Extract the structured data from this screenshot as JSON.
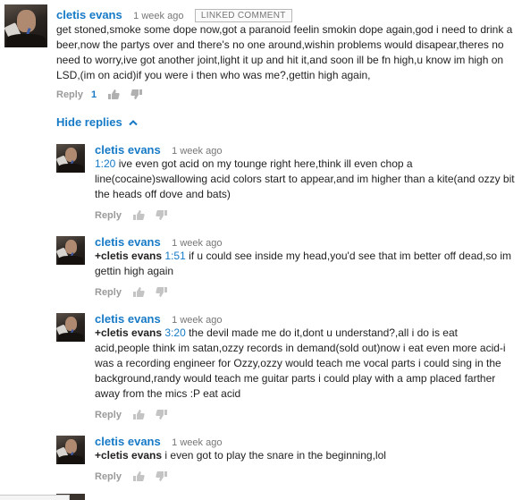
{
  "top_comment": {
    "author": "cletis evans",
    "time": "1 week ago",
    "badge": "LINKED COMMENT",
    "text": "get stoned,smoke some dope now,got a paranoid feelin smokin dope again,god i need to drink a beer,now the partys over and there's no one around,wishin problems would disapear,theres no need to worry,ive got another joint,light it up and hit it,and soon ill be fn high,u know im high on LSD,(im on acid)if you were i then who was me?,gettin high again,",
    "reply_label": "Reply",
    "like_count": "1"
  },
  "hide_replies_label": "Hide replies",
  "replies": [
    {
      "author": "cletis evans",
      "time": "1 week ago",
      "mention": "",
      "timestamp": "1:20",
      "text": " ive even got acid on my tounge right here,think ill even chop a line(cocaine)swallowing acid colors start to appear,and im higher than a kite(and ozzy bit the heads off dove and bats)",
      "reply_label": "Reply"
    },
    {
      "author": "cletis evans",
      "time": "1 week ago",
      "mention": "+cletis evans",
      "timestamp": "1:51",
      "text": " if u could see inside my head,you'd see that im better off dead,so im gettin high again",
      "reply_label": "Reply"
    },
    {
      "author": "cletis evans",
      "time": "1 week ago",
      "mention": "+cletis evans",
      "timestamp": "3:20",
      "text": " the devil made me do it,dont u understand?,all i do is eat acid,people think im satan,ozzy records in demand(sold out)now i eat even more acid-i was a recording engineer for Ozzy,ozzy would teach me vocal parts i could sing in the background,randy would teach me guitar parts i could play with a amp placed farther away from the mics :P eat acid",
      "reply_label": "Reply"
    },
    {
      "author": "cletis evans",
      "time": "1 week ago",
      "mention": "+cletis evans",
      "timestamp": "",
      "text": " i even got to play the snare in the beginning,lol",
      "reply_label": "Reply"
    }
  ],
  "icons": {
    "like": "thumbs-up-icon",
    "dislike": "thumbs-down-icon",
    "chevron": "chevron-up-icon"
  },
  "colors": {
    "author_blue": "#167ac6",
    "meta_gray": "#767676",
    "action_gray": "#9a9a9a"
  }
}
